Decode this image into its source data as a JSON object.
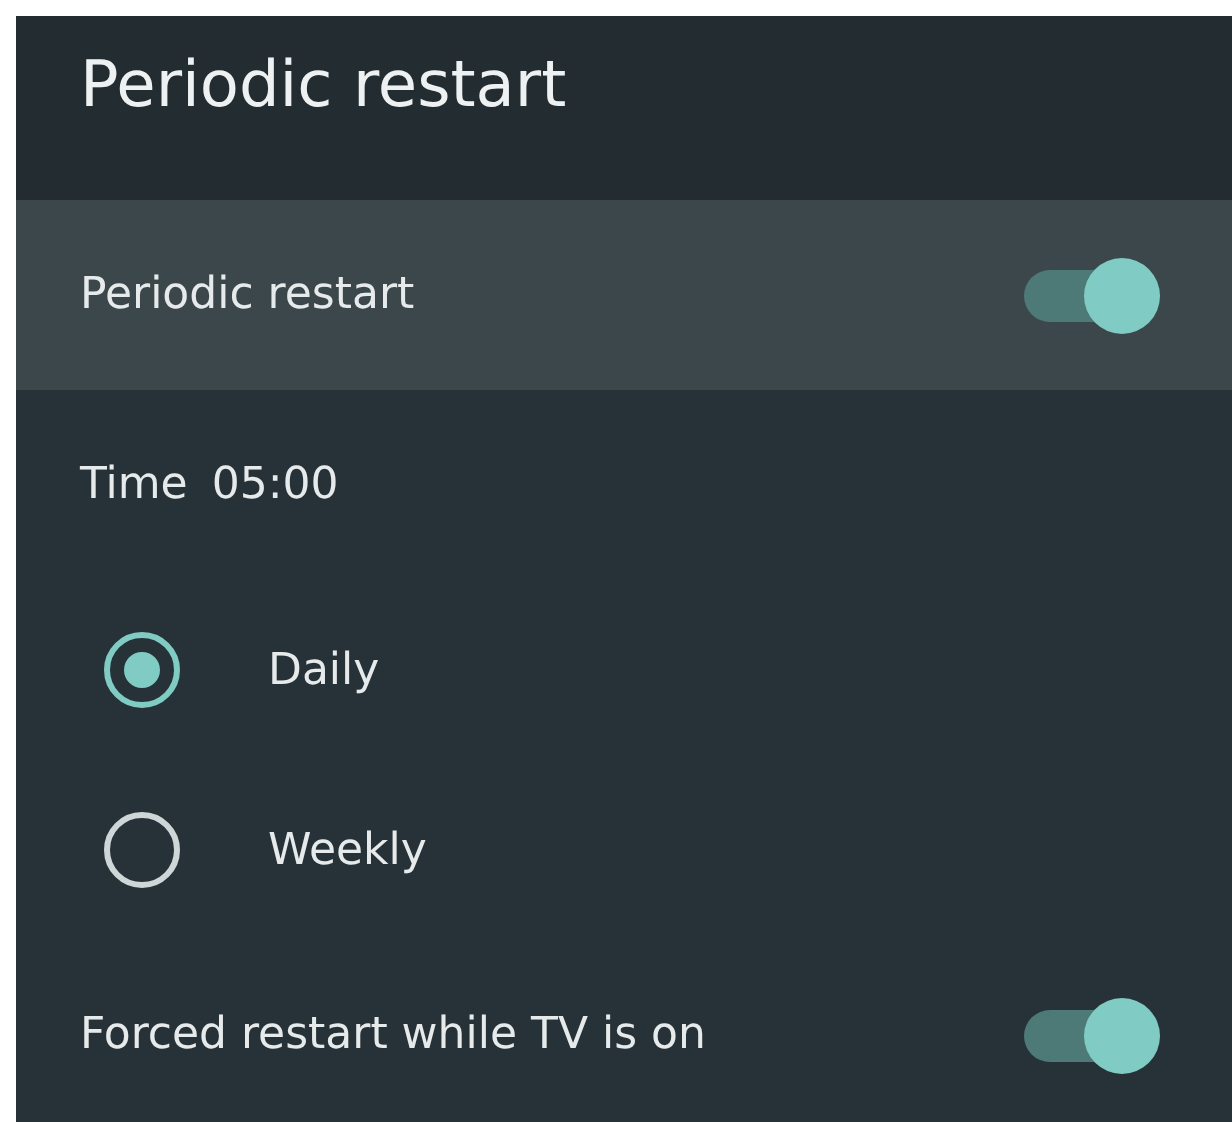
{
  "title": "Periodic restart",
  "items": [
    {
      "kind": "toggle",
      "label": "Periodic restart",
      "on": true,
      "highlighted": true
    },
    {
      "kind": "text",
      "label": "Time",
      "value": "05:00",
      "highlighted": false
    },
    {
      "kind": "radio",
      "label": "Daily",
      "selected": true,
      "highlighted": false
    },
    {
      "kind": "radio",
      "label": "Weekly",
      "selected": false,
      "highlighted": false
    },
    {
      "kind": "toggle",
      "label": "Forced restart while TV is on",
      "on": true,
      "highlighted": false
    }
  ]
}
